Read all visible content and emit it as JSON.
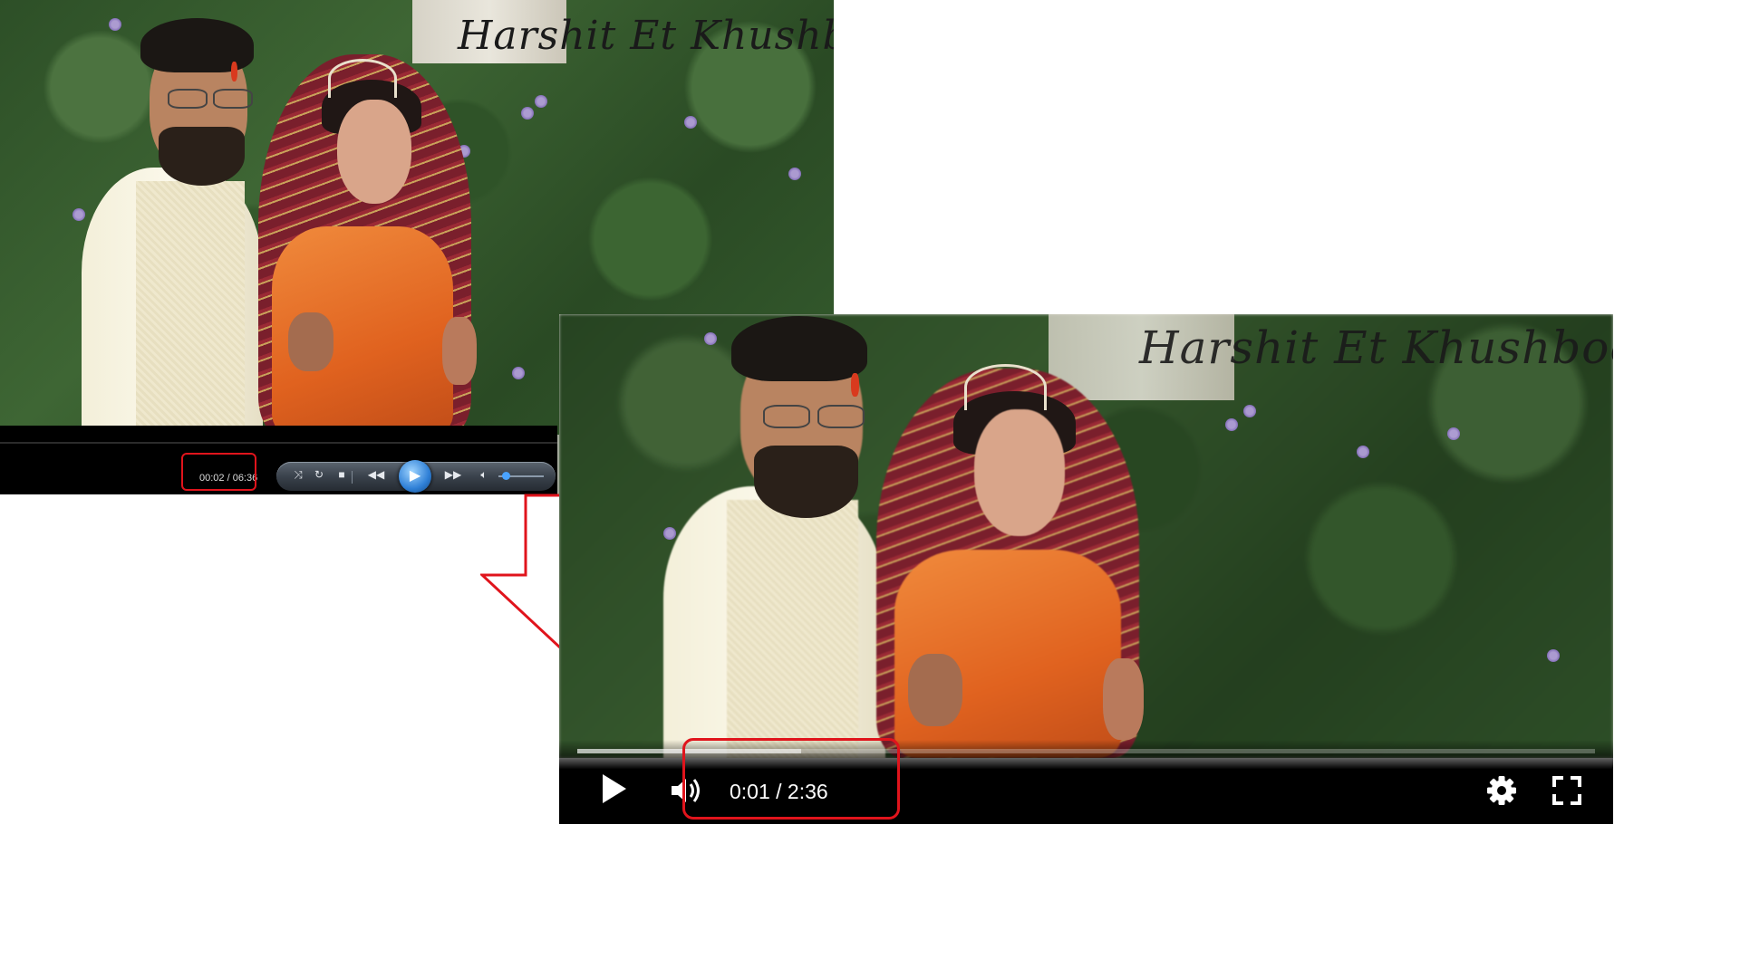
{
  "old_player": {
    "title_overlay": "Harshit Et Khushboo",
    "time_display": "00:02 / 06:36",
    "controls": {
      "shuffle_icon": "shuffle-icon",
      "repeat_icon": "repeat-icon",
      "stop_icon": "stop-icon",
      "previous_icon": "rewind-icon",
      "play_icon": "play-icon",
      "next_icon": "fast-forward-icon",
      "volume_icon": "volume-icon"
    },
    "volume_level": 0.05
  },
  "new_player": {
    "title_overlay": "Harshit Et Khushboo",
    "time_display": "0:01 / 2:36",
    "progress_fraction": 0.22,
    "controls": {
      "play_icon": "play-icon",
      "volume_icon": "volume-icon",
      "settings_icon": "gear-icon",
      "fullscreen_icon": "fullscreen-icon"
    }
  },
  "annotation": {
    "arrow": "down-arrow",
    "highlight_color": "#e0141c"
  }
}
